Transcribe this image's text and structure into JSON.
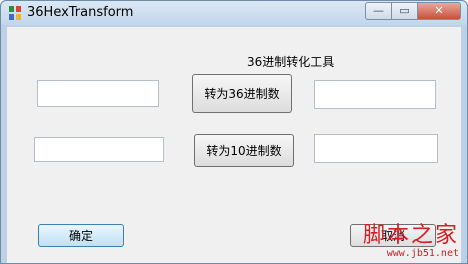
{
  "window": {
    "title": "36HexTransform"
  },
  "titlebar_controls": {
    "minimize": "—",
    "maximize": "▭",
    "close": "✕"
  },
  "form": {
    "label": "36进制转化工具",
    "to36_button": "转为36进制数",
    "to10_button": "转为10进制数",
    "ok_button": "确定",
    "cancel_button": "取消"
  },
  "watermark": {
    "main": "脚本之家",
    "sub": "www.jb51.net"
  }
}
